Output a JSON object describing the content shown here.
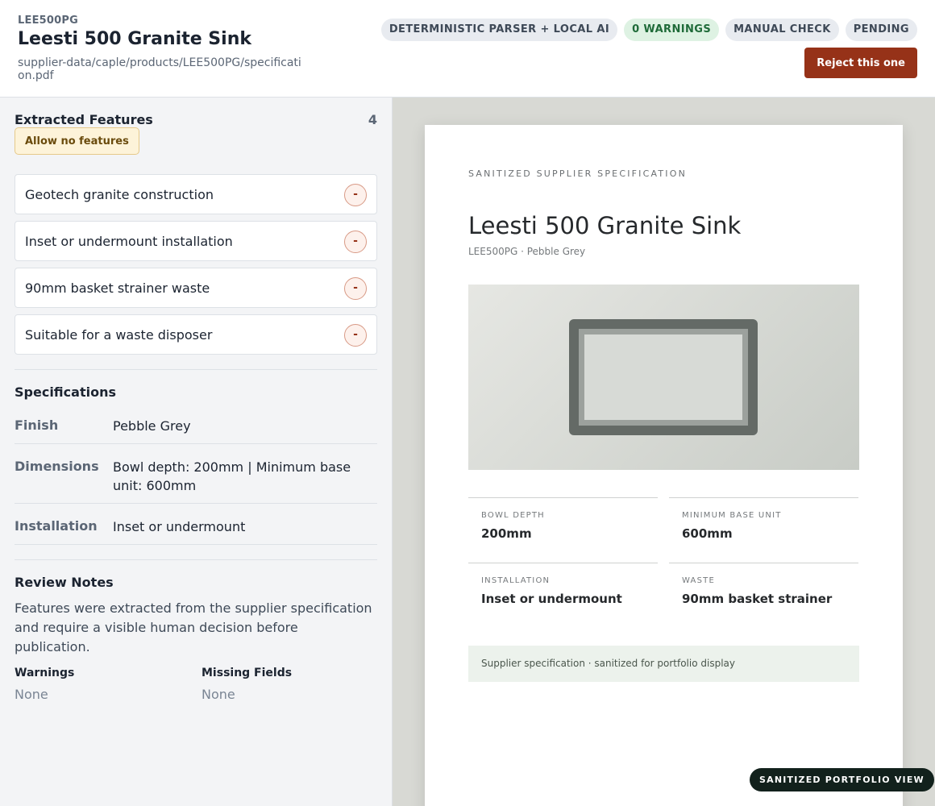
{
  "header": {
    "sku": "LEE500PG",
    "title": "Leesti 500 Granite Sink",
    "path": "supplier-data/caple/products/LEE500PG/specification.pdf",
    "badges": [
      "DETERMINISTIC PARSER + LOCAL AI",
      "0 WARNINGS",
      "MANUAL CHECK",
      "PENDING"
    ],
    "reject_label": "Reject this one"
  },
  "features": {
    "title": "Extracted Features",
    "count": "4",
    "allow_none_label": "Allow no features",
    "remove_label": "-",
    "items": [
      "Geotech granite construction",
      "Inset or undermount installation",
      "90mm basket strainer waste",
      "Suitable for a waste disposer"
    ]
  },
  "specifications": {
    "title": "Specifications",
    "rows": [
      {
        "key": "Finish",
        "value": "Pebble Grey"
      },
      {
        "key": "Dimensions",
        "value": "Bowl depth: 200mm | Minimum base unit: 600mm"
      },
      {
        "key": "Installation",
        "value": "Inset or undermount"
      }
    ]
  },
  "review": {
    "title": "Review Notes",
    "text": "Features were extracted from the supplier specification and require a visible human decision before publication.",
    "warnings_title": "Warnings",
    "warnings_value": "None",
    "missing_title": "Missing Fields",
    "missing_value": "None"
  },
  "document": {
    "kicker": "SANITIZED SUPPLIER SPECIFICATION",
    "title": "Leesti 500 Granite Sink",
    "subtitle": "LEE500PG · Pebble Grey",
    "cells": [
      {
        "label": "BOWL DEPTH",
        "value": "200mm"
      },
      {
        "label": "MINIMUM BASE UNIT",
        "value": "600mm"
      },
      {
        "label": "INSTALLATION",
        "value": "Inset or undermount"
      },
      {
        "label": "WASTE",
        "value": "90mm basket strainer"
      }
    ],
    "footer": "Supplier specification · sanitized for portfolio display",
    "portfolio_label": "SANITIZED PORTFOLIO VIEW"
  },
  "colors": {
    "accent_reject": "#963218",
    "ok_badge": "#def2e3",
    "allow_none": "#fdf3d9",
    "viewer_background": "#d8d9d4"
  }
}
